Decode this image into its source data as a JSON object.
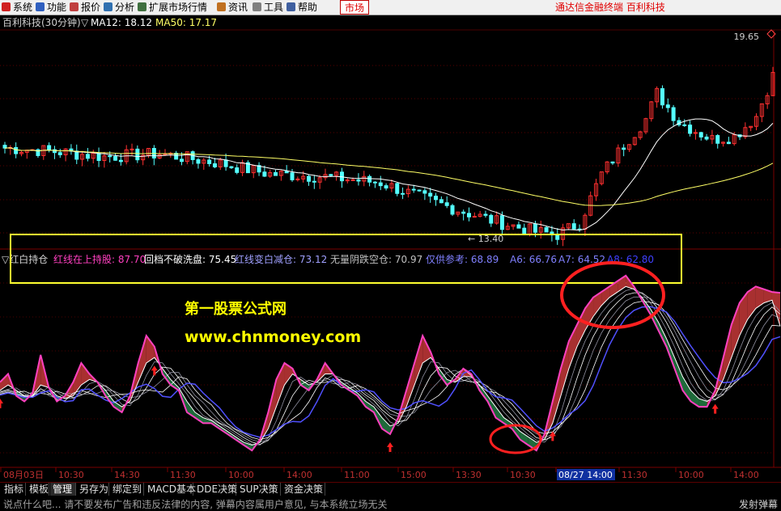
{
  "menu": {
    "items": [
      {
        "label": "系统",
        "icon_color": "#d02020"
      },
      {
        "label": "功能",
        "icon_color": "#3060c0"
      },
      {
        "label": "报价",
        "icon_color": "#c04040"
      },
      {
        "label": "分析",
        "icon_color": "#3070b0"
      },
      {
        "label": "扩展市场行情",
        "icon_color": "#407040"
      },
      {
        "label": "资讯",
        "icon_color": "#c07020"
      },
      {
        "label": "工具",
        "icon_color": "#808080"
      },
      {
        "label": "帮助",
        "icon_color": "#4060a0"
      }
    ],
    "market_tab": "市场",
    "brand": "通达信金融终端  百利科技"
  },
  "main_panel": {
    "title": "百利科技(30分钟)",
    "ma12_label": "MA12: 18.12",
    "ma50_label": "MA50: 17.17",
    "high_label": "19.65",
    "low_label": "← 13.40"
  },
  "indicator_panel": {
    "marker": "▽",
    "name": "红白持仓",
    "items": [
      {
        "text": "红线在上持股: 87.70",
        "color": "#ff40c0"
      },
      {
        "text": "回档不破洗盘: 75.45",
        "color": "#ffffff"
      },
      {
        "text": "红线变白减仓: 73.12",
        "color": "#a0a0ff"
      },
      {
        "text": "无量阴跌空仓: 70.97",
        "color": "#c0c0c0"
      },
      {
        "text": "仅供参考: 68.89",
        "color": "#8080ff"
      },
      {
        "text": "A6: 66.76",
        "color": "#8080ff"
      },
      {
        "text": "A7: 64.52",
        "color": "#8080ff"
      },
      {
        "text": "A8: 62.80",
        "color": "#4040ff"
      }
    ]
  },
  "watermark": {
    "line1": "第一股票公式网",
    "line2": "www.chnmoney.com"
  },
  "time_axis": {
    "labels": [
      "08月03日",
      "10:30",
      "14:30",
      "11:30",
      "10:00",
      "14:00",
      "11:00",
      "15:00",
      "13:30",
      "10:30",
      "08/27 14:00",
      "11:30",
      "10:00",
      "14:00"
    ],
    "highlight_label": "08/27 14:00"
  },
  "bottom_tabs": [
    "指标",
    "模板",
    "管理",
    "另存为",
    "绑定到",
    "MACD基本",
    "DDE决策",
    "SUP决策",
    "资金决策"
  ],
  "active_tab": "管理",
  "status": {
    "notice": "说点什么吧... 请不要发布广告和违反法律的内容, 弹幕内容属用户意见, 与本系统立场无关",
    "fullscreen": "发射弹幕"
  },
  "colors": {
    "up": "#ff3030",
    "down": "#54ffff",
    "ma12": "#ffffff",
    "ma50": "#ffff66",
    "ribbon_red": "#a83030",
    "ribbon_green": "#1e6a3a",
    "line_magenta": "#ff40c0",
    "line_blue": "#5050ff",
    "highlight_box": "#ffff30",
    "circle": "#ff2020"
  },
  "chart_data": [
    {
      "type": "candlestick",
      "title": "百利科技(30分钟)",
      "series": [
        {
          "name": "MA12",
          "last": 18.12
        },
        {
          "name": "MA50",
          "last": 17.17
        }
      ],
      "high": 19.65,
      "low": 13.4,
      "ylim": [
        13.0,
        20.0
      ]
    },
    {
      "type": "line",
      "title": "红白持仓",
      "series": [
        {
          "name": "红线在上持股",
          "last": 87.7
        },
        {
          "name": "回档不破洗盘",
          "last": 75.45
        },
        {
          "name": "红线变白减仓",
          "last": 73.12
        },
        {
          "name": "无量阴跌空仓",
          "last": 70.97
        },
        {
          "name": "仅供参考",
          "last": 68.89
        },
        {
          "name": "A6",
          "last": 66.76
        },
        {
          "name": "A7",
          "last": 64.52
        },
        {
          "name": "A8",
          "last": 62.8
        }
      ],
      "red_line": [
        55,
        58,
        50,
        48,
        51,
        65,
        53,
        48,
        50,
        55,
        62,
        58,
        55,
        50,
        46,
        44,
        50,
        62,
        72,
        68,
        58,
        54,
        52,
        44,
        42,
        40,
        40,
        38,
        36,
        34,
        32,
        30,
        34,
        44,
        56,
        62,
        60,
        54,
        52,
        56,
        62,
        58,
        54,
        52,
        50,
        46,
        44,
        38,
        36,
        42,
        52,
        62,
        72,
        66,
        58,
        54,
        56,
        60,
        58,
        52,
        48,
        42,
        40,
        38,
        34,
        32,
        30,
        36,
        48,
        60,
        70,
        76,
        82,
        86,
        88,
        90,
        92,
        94,
        90,
        85,
        80,
        74,
        68,
        60,
        52,
        48,
        46,
        46,
        52,
        64,
        76,
        84,
        88,
        90,
        89,
        88,
        87.7
      ],
      "white_line": [
        52,
        54,
        52,
        50,
        50,
        54,
        53,
        50,
        49,
        50,
        54,
        56,
        55,
        52,
        48,
        46,
        48,
        55,
        62,
        64,
        60,
        56,
        53,
        48,
        44,
        42,
        41,
        39,
        37,
        35,
        33,
        32,
        33,
        38,
        46,
        54,
        58,
        56,
        54,
        55,
        58,
        58,
        55,
        53,
        51,
        48,
        46,
        42,
        39,
        40,
        46,
        54,
        62,
        64,
        60,
        56,
        55,
        57,
        57,
        54,
        50,
        46,
        42,
        40,
        37,
        35,
        33,
        34,
        40,
        50,
        60,
        68,
        74,
        79,
        83,
        86,
        88,
        90,
        89,
        86,
        82,
        77,
        71,
        64,
        57,
        52,
        49,
        48,
        50,
        56,
        64,
        72,
        78,
        82,
        84,
        85,
        75.45
      ],
      "buy_signals": [
        0,
        19,
        48,
        68,
        88
      ]
    }
  ]
}
